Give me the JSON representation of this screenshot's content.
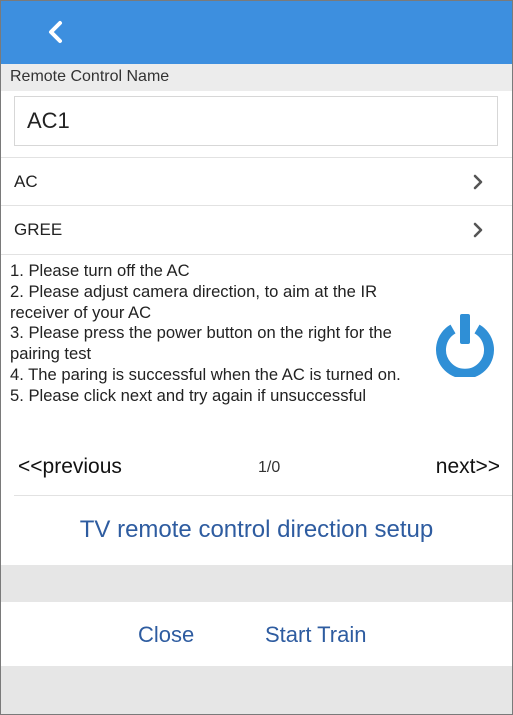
{
  "colors": {
    "accent": "#3d8fdf",
    "link": "#2e5ca0",
    "power_icon": "#2f8fd6",
    "panel_gray": "#e6e6e6"
  },
  "header": {
    "back_icon": "chevron-left-icon"
  },
  "form": {
    "name_label": "Remote Control Name",
    "name_value": "AC1"
  },
  "selectors": [
    {
      "label": "AC",
      "icon": "chevron-right-icon"
    },
    {
      "label": "GREE",
      "icon": "chevron-right-icon"
    }
  ],
  "instructions": [
    "1. Please turn off the AC",
    "2. Please adjust camera direction, to aim at the IR receiver of your AC",
    "3. Please press the power button on the right for the pairing test",
    "4. The paring is successful when the AC is turned on.",
    "5. Please click next and try again if unsuccessful"
  ],
  "power_button": {
    "icon": "power-icon"
  },
  "pager": {
    "previous_label": "<<previous",
    "page_indicator": "1/0",
    "next_label": "next>>"
  },
  "tv_setup_label": "TV remote control direction setup",
  "actions": {
    "close_label": "Close",
    "start_train_label": "Start Train"
  }
}
